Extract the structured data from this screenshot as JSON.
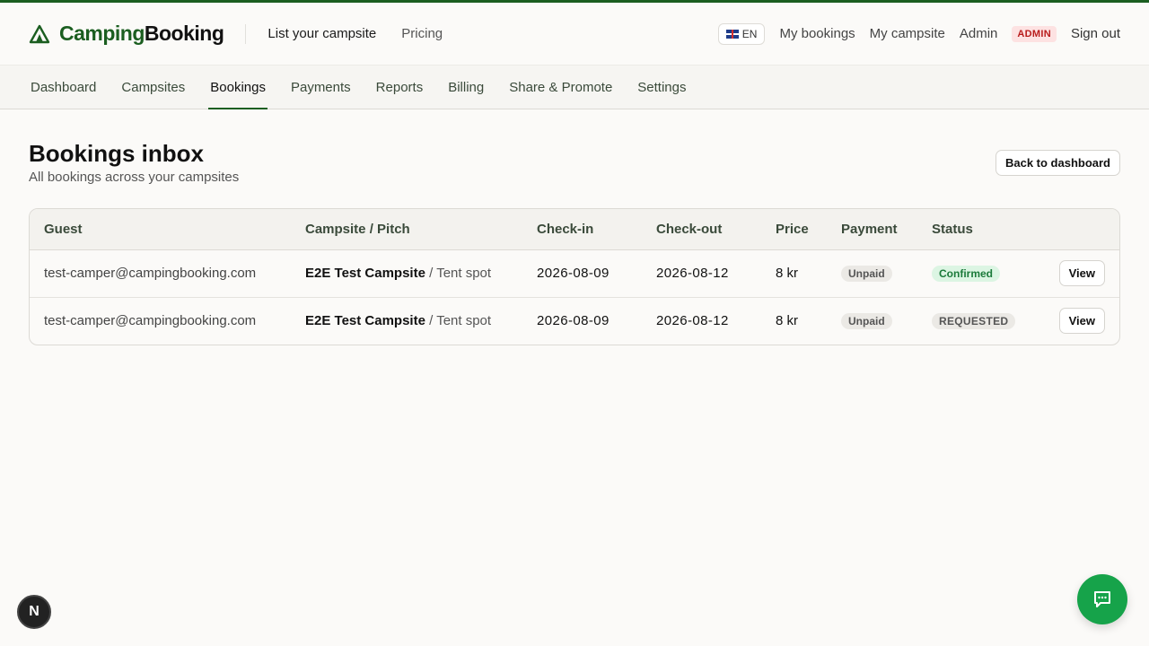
{
  "brand": {
    "name_part1": "Camping",
    "name_part2": "Booking",
    "color": "#1b5e20"
  },
  "topnav": {
    "links": [
      "List your campsite",
      "Pricing"
    ],
    "language": "EN",
    "right_links": [
      "My bookings",
      "My campsite",
      "Admin"
    ],
    "admin_badge": "ADMIN",
    "sign_out": "Sign out"
  },
  "subnav": {
    "items": [
      "Dashboard",
      "Campsites",
      "Bookings",
      "Payments",
      "Reports",
      "Billing",
      "Share & Promote",
      "Settings"
    ],
    "active": "Bookings"
  },
  "page": {
    "title": "Bookings inbox",
    "subtitle": "All bookings across your campsites",
    "back_button": "Back to dashboard"
  },
  "table": {
    "headers": [
      "Guest",
      "Campsite / Pitch",
      "Check-in",
      "Check-out",
      "Price",
      "Payment",
      "Status",
      ""
    ],
    "rows": [
      {
        "guest": "test-camper@campingbooking.com",
        "campsite": "E2E Test Campsite",
        "pitch": "/ Tent spot",
        "check_in": "2026-08-09",
        "check_out": "2026-08-12",
        "price": "8 kr",
        "payment": "Unpaid",
        "status": "Confirmed",
        "action": "View"
      },
      {
        "guest": "test-camper@campingbooking.com",
        "campsite": "E2E Test Campsite",
        "pitch": "/ Tent spot",
        "check_in": "2026-08-09",
        "check_out": "2026-08-12",
        "price": "8 kr",
        "payment": "Unpaid",
        "status": "REQUESTED",
        "action": "View"
      }
    ]
  },
  "floating": {
    "dev_badge": "N",
    "chat_icon": "chat-bubble-icon"
  },
  "colors": {
    "accent": "#1b5e20",
    "chat_button": "#16a34a",
    "confirmed": "#1b7a3a",
    "admin": "#b91c1c"
  }
}
